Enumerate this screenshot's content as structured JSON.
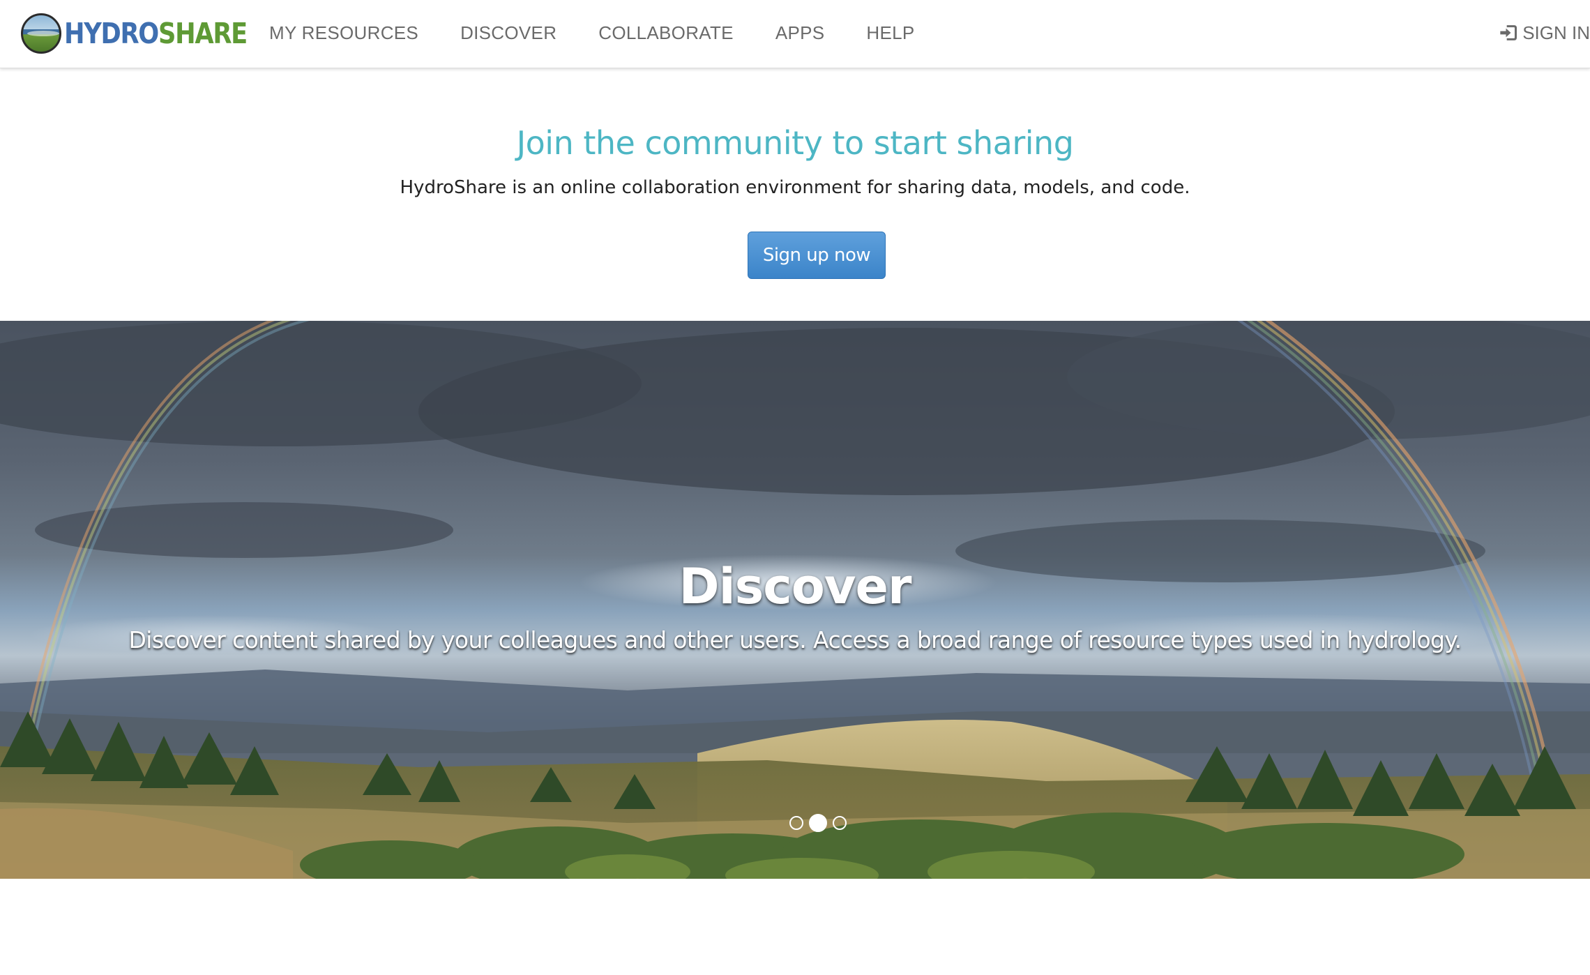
{
  "brand": {
    "part1": "HYDRO",
    "part2": "SHARE",
    "colors": {
      "hydro": "#3f6fb0",
      "share": "#5e9a35"
    }
  },
  "nav": {
    "items": [
      {
        "label": "MY RESOURCES"
      },
      {
        "label": "DISCOVER"
      },
      {
        "label": "COLLABORATE"
      },
      {
        "label": "APPS"
      },
      {
        "label": "HELP"
      }
    ],
    "signin": {
      "label": "SIGN IN",
      "icon": "sign-in-icon"
    }
  },
  "hero": {
    "title": "Join the community to start sharing",
    "subtitle": "HydroShare is an online collaboration environment for sharing data, models, and code.",
    "cta_label": "Sign up now",
    "title_color": "#4db6c4",
    "cta_color": "#428bca"
  },
  "carousel": {
    "slide_title": "Discover",
    "slide_text": "Discover content shared by your colleagues and other users. Access a broad range of resource types used in hydrology.",
    "slide_count": 3,
    "active_index": 1
  }
}
